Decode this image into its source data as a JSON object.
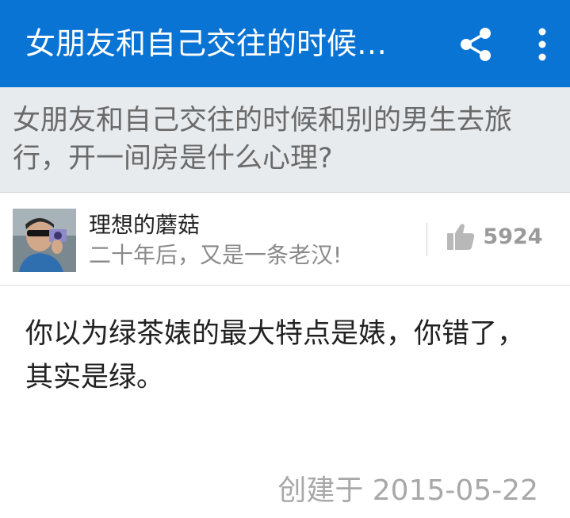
{
  "appbar": {
    "title": "女朋友和自己交往的时候…",
    "share_icon": "share-icon",
    "more_icon": "more-vertical-icon",
    "color": "#0a74d5"
  },
  "question": {
    "title": "女朋友和自己交往的时候和别的男生去旅行，开一间房是什么心理?"
  },
  "answer": {
    "author_name": "理想的蘑菇",
    "author_bio": "二十年后，又是一条老汉!",
    "likes": "5924",
    "like_icon": "thumbs-up-icon",
    "content": "你以为绿茶婊的最大特点是婊，你错了，其实是绿。",
    "created": "创建于 2015-05-22"
  }
}
